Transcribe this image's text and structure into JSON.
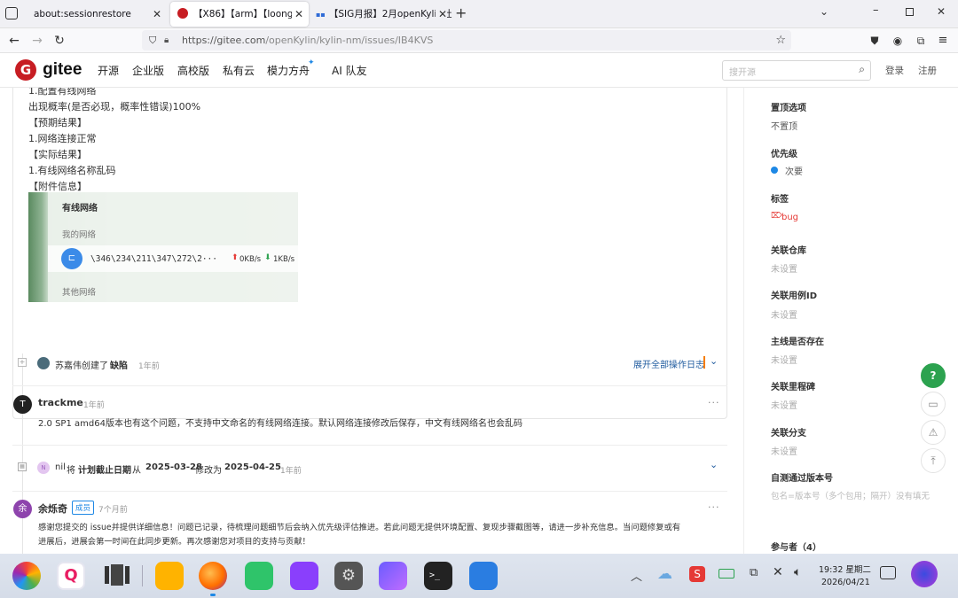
{
  "tabs": [
    {
      "title": "about:sessionrestore"
    },
    {
      "title": "【X86】【arm】【loongar"
    },
    {
      "title": "【SIG月报】2月openKylin社"
    }
  ],
  "nav": {
    "url_host": "https://gitee.com",
    "url_path": "/openKylin/kylin-nm/issues/IB4KVS"
  },
  "gitee": {
    "logo": "gitee",
    "menu": [
      "开源",
      "企业版",
      "高校版",
      "私有云",
      "模力方舟",
      "AI 队友"
    ],
    "search_placeholder": "搜开源",
    "login": "登录",
    "register": "注册"
  },
  "issue": {
    "lines": [
      "1.配置有线网络",
      "出现概率(是否必现，概率性错误)100%",
      "【预期结果】",
      "1.网络连接正常",
      "【实际结果】",
      "1.有线网络名称乱码",
      "【附件信息】"
    ],
    "screenshot": {
      "title": "有线网络",
      "my_network": "我的网络",
      "network_name": "\\346\\234\\211\\347\\272\\2···",
      "up_speed": "0KB/s",
      "down_speed": "1KB/s",
      "other": "其他网络"
    }
  },
  "timeline": {
    "created_user": "苏嘉伟创建了",
    "created_type": "缺陷",
    "created_time": "1年前",
    "expand_log": "展开全部操作日志",
    "comment1": {
      "avatar": "T",
      "user": "trackme",
      "time": "1年前",
      "text": "2.0 SP1 amd64版本也有这个问题，不支持中文命名的有线网络连接。默认网络连接修改后保存，中文有线网络名也会乱码"
    },
    "change": {
      "avatar": "N",
      "user": "nil",
      "verb": "将",
      "field": "计划截止日期",
      "from_word": "从",
      "from": "2025-03-28",
      "to_word": "修改为",
      "to": "2025-04-25",
      "time": "1年前"
    },
    "comment2": {
      "avatar": "余",
      "user": "余烁奇",
      "badge": "成员",
      "time": "7个月前",
      "line1": "感谢您提交的 issue并提供详细信息！问题已记录，待梳理问题细节后会纳入优先级评估推进。若此问题无提供环境配置、复现步骤截图等，请进一步补充信息。当问题修复或有",
      "line2": "进展后，进展会第一时间在此同步更新。再次感谢您对项目的支持与贡献！"
    }
  },
  "sidebar": {
    "pin_label": "置顶选项",
    "pin_value": "不置顶",
    "priority_label": "优先级",
    "priority_value": "次要",
    "tags_label": "标签",
    "tag_value": "bug",
    "repo_label": "关联仓库",
    "repo_value": "未设置",
    "case_label": "关联用例ID",
    "case_value": "未设置",
    "mainline_label": "主线是否存在",
    "mainline_value": "未设置",
    "milestone_label": "关联里程碑",
    "milestone_value": "未设置",
    "branch_label": "关联分支",
    "branch_value": "未设置",
    "selftest_label": "自测通过版本号",
    "selftest_placeholder": "包名=版本号（多个包用；隔开）没有填无",
    "participants": "参与者（4）"
  },
  "floating": {
    "help": "?"
  },
  "taskbar": {
    "time": "19:32 星期二",
    "date": "2026/04/21"
  },
  "colors": {
    "gitee_red": "#c71d23",
    "priority_blue": "#1e88e5",
    "link_blue": "#1e5a9e",
    "help_green": "#2ca24f",
    "tag_red": "#e53935"
  }
}
